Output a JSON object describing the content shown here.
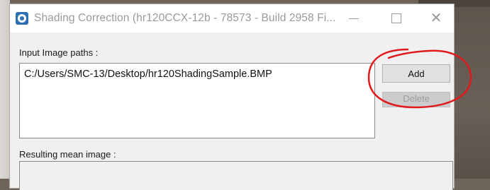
{
  "window": {
    "title": "Shading Correction (hr120CCX-12b - 78573 - Build 2958 Fi...",
    "minimize_glyph": "—",
    "maximize_glyph": "□",
    "close_glyph": "✕"
  },
  "form": {
    "input_paths_label": "Input Image paths :",
    "paths": [
      "C:/Users/SMC-13/Desktop/hr120ShadingSample.BMP"
    ],
    "add_label": "Add",
    "delete_label": "Delete",
    "mean_image_label": "Resulting  mean image :"
  },
  "colors": {
    "annotation": "#e0191b",
    "window_bg": "#f0f0f0"
  },
  "icons": [
    "app-icon",
    "minimize-icon",
    "maximize-icon",
    "close-icon"
  ]
}
